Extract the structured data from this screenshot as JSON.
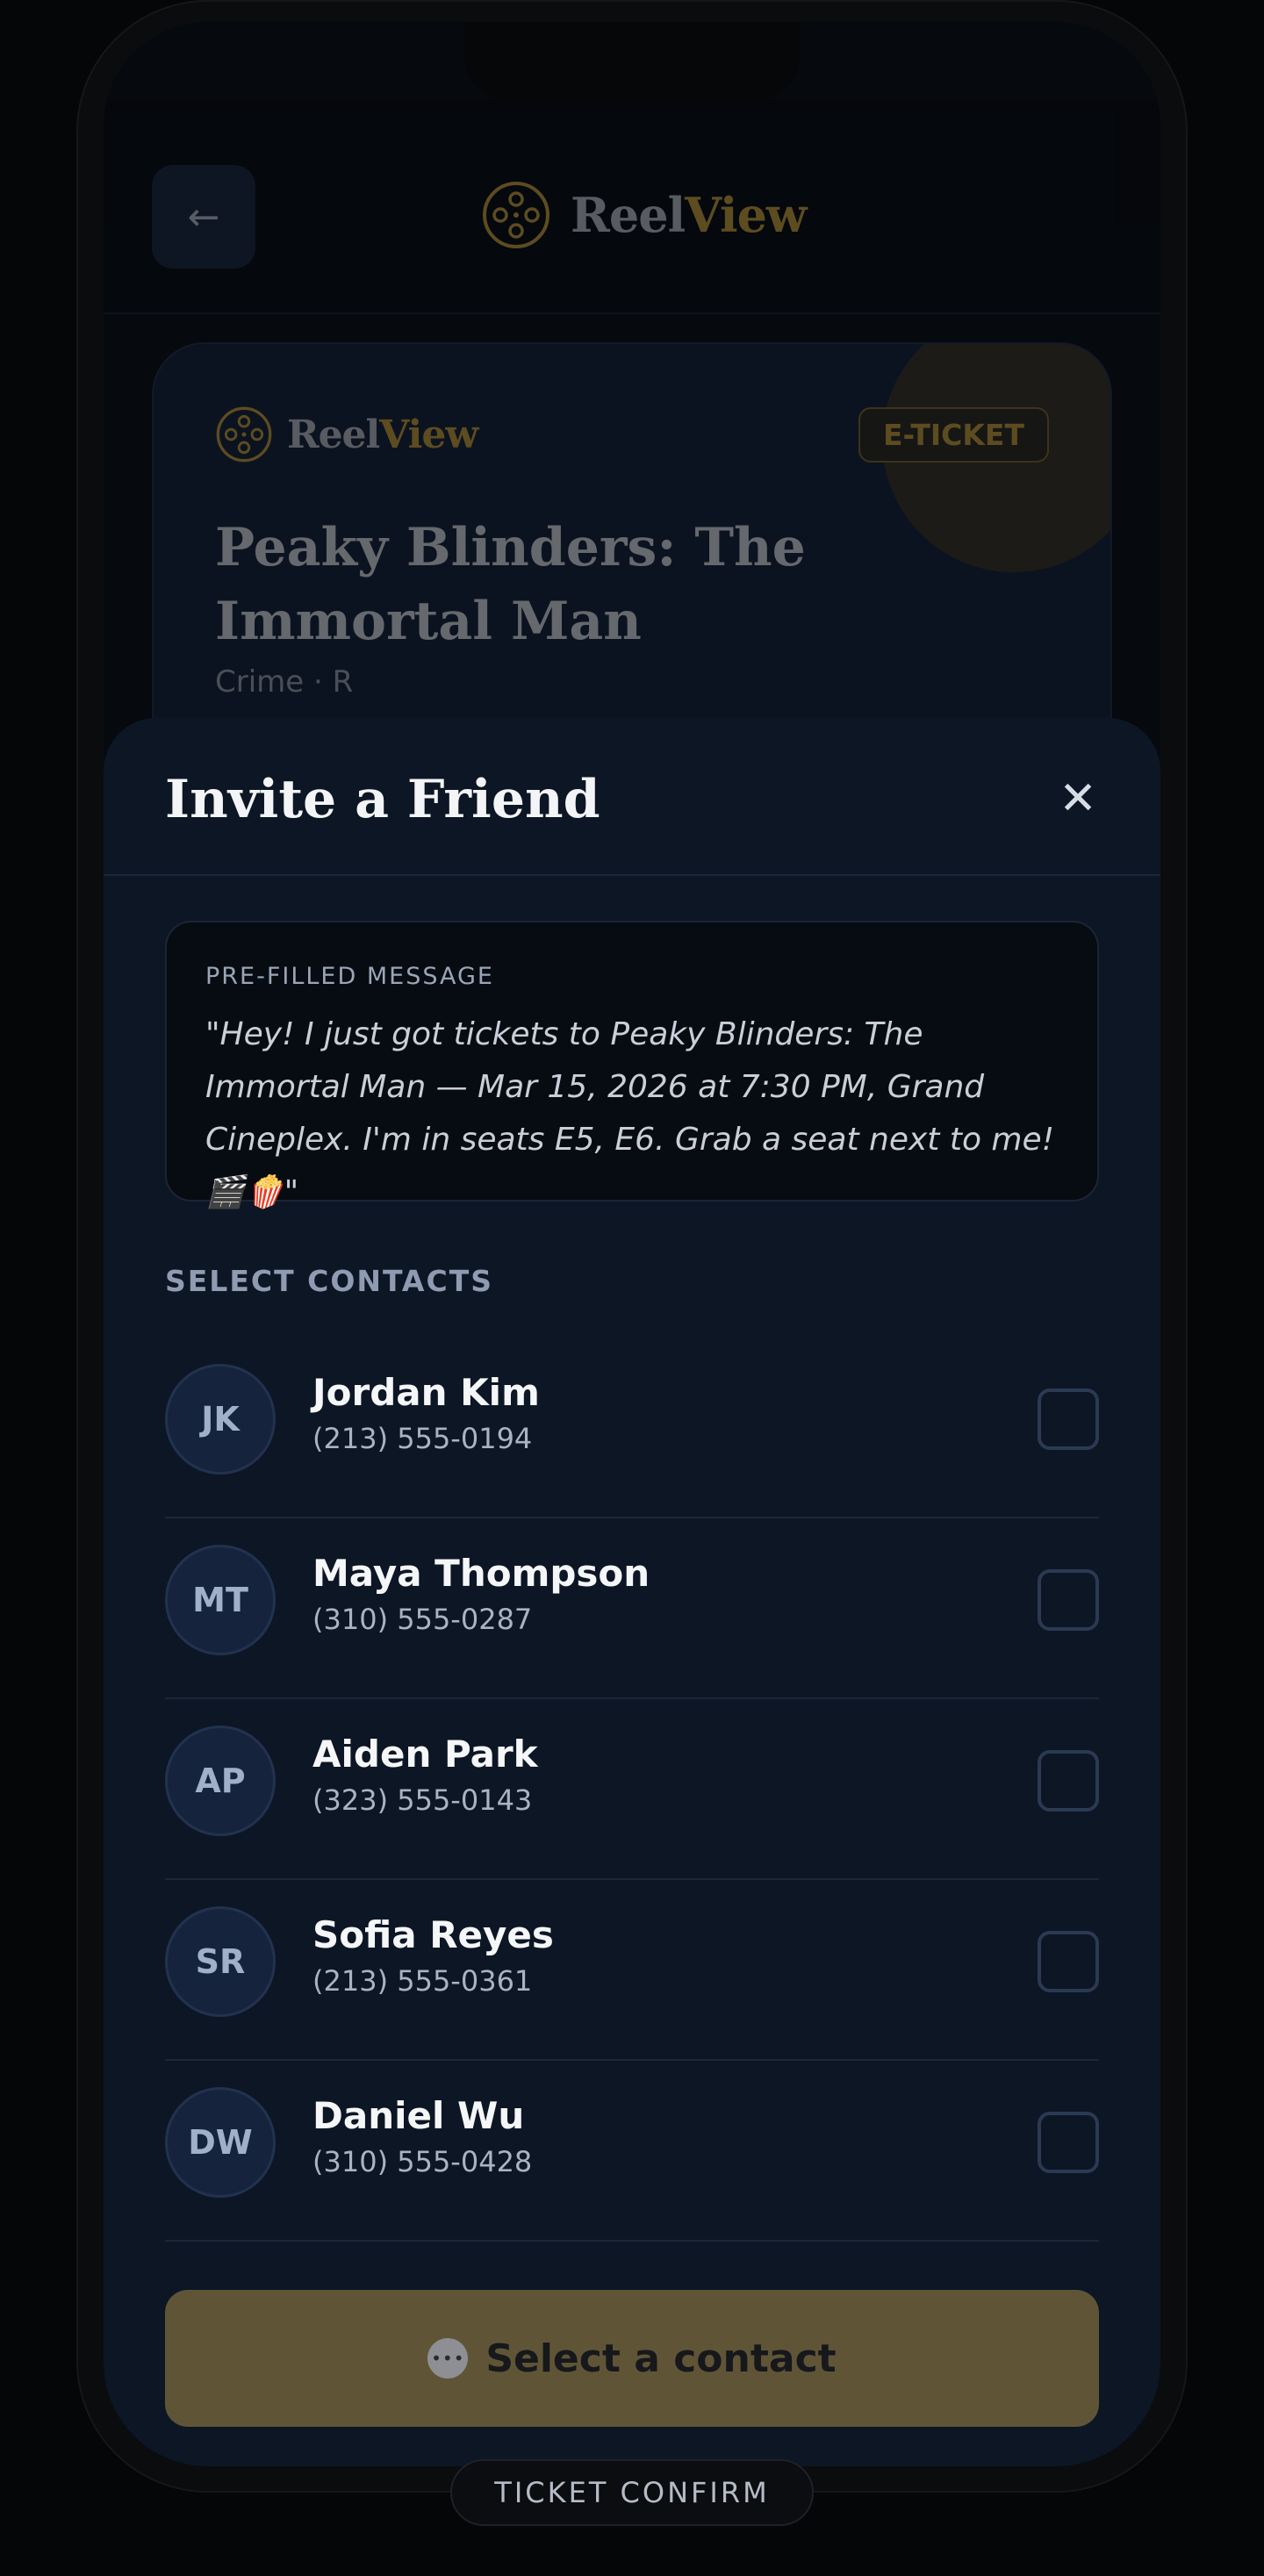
{
  "app": {
    "brand_part1": "Reel",
    "brand_part2": "View",
    "back_label": "←"
  },
  "ticket": {
    "brand_part1": "Reel",
    "brand_part2": "View",
    "badge": "E-TICKET",
    "title": "Peaky Blinders: The Immortal Man",
    "meta": "Crime · R"
  },
  "sheet": {
    "title": "Invite a Friend",
    "close_label": "✕",
    "message_label": "PRE-FILLED MESSAGE",
    "message": "\"Hey! I just got tickets to Peaky Blinders: The Immortal Man — Mar 15, 2026 at 7:30 PM, Grand Cineplex. I'm in seats E5, E6. Grab a seat next to me! 🎬🍿\"",
    "contacts_label": "SELECT CONTACTS",
    "contacts": [
      {
        "initials": "JK",
        "name": "Jordan Kim",
        "phone": "(213) 555-0194",
        "selected": false
      },
      {
        "initials": "MT",
        "name": "Maya Thompson",
        "phone": "(310) 555-0287",
        "selected": false
      },
      {
        "initials": "AP",
        "name": "Aiden Park",
        "phone": "(323) 555-0143",
        "selected": false
      },
      {
        "initials": "SR",
        "name": "Sofia Reyes",
        "phone": "(213) 555-0361",
        "selected": false
      },
      {
        "initials": "DW",
        "name": "Daniel Wu",
        "phone": "(310) 555-0428",
        "selected": false
      }
    ],
    "cta_icon": "chat-bubble-icon",
    "cta_icon_glyph": "•••",
    "cta_label": "Select a contact"
  },
  "footer_pill": "TICKET CONFIRM",
  "colors": {
    "accent_gold": "#d6a93b",
    "sheet_bg": "#0d1625",
    "cta_bg": "#5f5536"
  }
}
